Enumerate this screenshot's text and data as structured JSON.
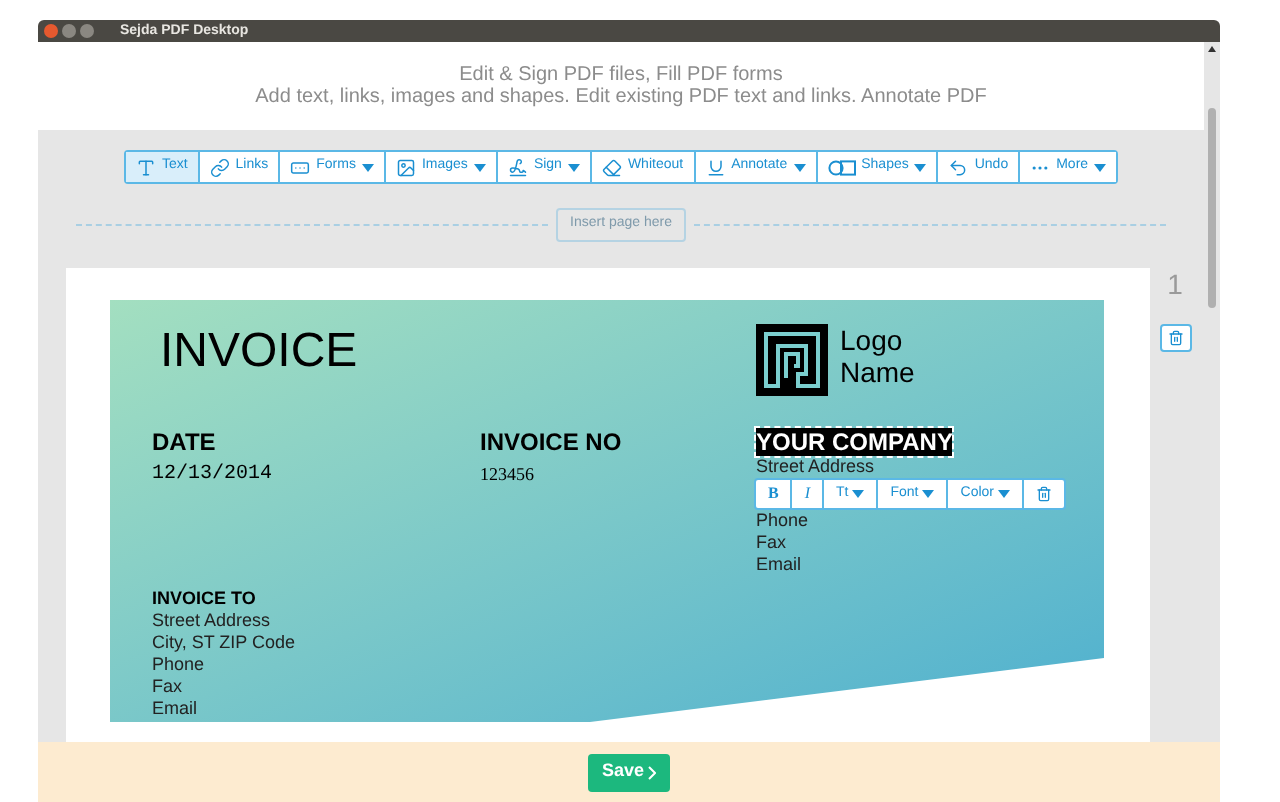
{
  "window": {
    "title": "Sejda PDF Desktop"
  },
  "header": {
    "lines": [
      "Edit & Sign PDF files, Fill PDF forms",
      "Add text, links, images and shapes. Edit existing PDF text and links. Annotate PDF"
    ]
  },
  "toolbar": [
    {
      "kind": "text",
      "label": "Text",
      "selected": true,
      "has_menu": false
    },
    {
      "kind": "link",
      "label": "Links",
      "selected": false,
      "has_menu": false
    },
    {
      "kind": "form",
      "label": "Forms",
      "selected": false,
      "has_menu": true
    },
    {
      "kind": "image",
      "label": "Images",
      "selected": false,
      "has_menu": true
    },
    {
      "kind": "sign",
      "label": "Sign",
      "selected": false,
      "has_menu": true
    },
    {
      "kind": "whiteout",
      "label": "Whiteout",
      "selected": false,
      "has_menu": false
    },
    {
      "kind": "annotate",
      "label": "Annotate",
      "selected": false,
      "has_menu": true
    },
    {
      "kind": "shapes",
      "label": "Shapes",
      "selected": false,
      "has_menu": true
    },
    {
      "kind": "undo",
      "label": "Undo",
      "selected": false,
      "has_menu": false
    },
    {
      "kind": "more",
      "label": "More",
      "selected": false,
      "has_menu": true
    }
  ],
  "insert_page": "Insert page here",
  "page_number": "1",
  "invoice": {
    "title": "INVOICE",
    "logo": [
      "Logo",
      "Name"
    ],
    "date_label": "DATE",
    "date": "12/13/2014",
    "number_label": "INVOICE NO",
    "number": "123456",
    "company": "YOUR COMPANY",
    "company_lines": [
      "Street Address",
      "Phone",
      "Fax",
      "Email"
    ],
    "to_label": "INVOICE TO",
    "to_lines": [
      "Street Address",
      "City, ST ZIP Code",
      "Phone",
      "Fax",
      "Email"
    ]
  },
  "text_toolbar": [
    {
      "kind": "bold",
      "label": "B",
      "has_menu": false
    },
    {
      "kind": "italic",
      "label": "I",
      "has_menu": false
    },
    {
      "kind": "size",
      "label": "Tt",
      "has_menu": true
    },
    {
      "kind": "font",
      "label": "Font",
      "has_menu": true
    },
    {
      "kind": "color",
      "label": "Color",
      "has_menu": true
    },
    {
      "kind": "delete",
      "has_menu": false
    }
  ],
  "save_button": "Save"
}
